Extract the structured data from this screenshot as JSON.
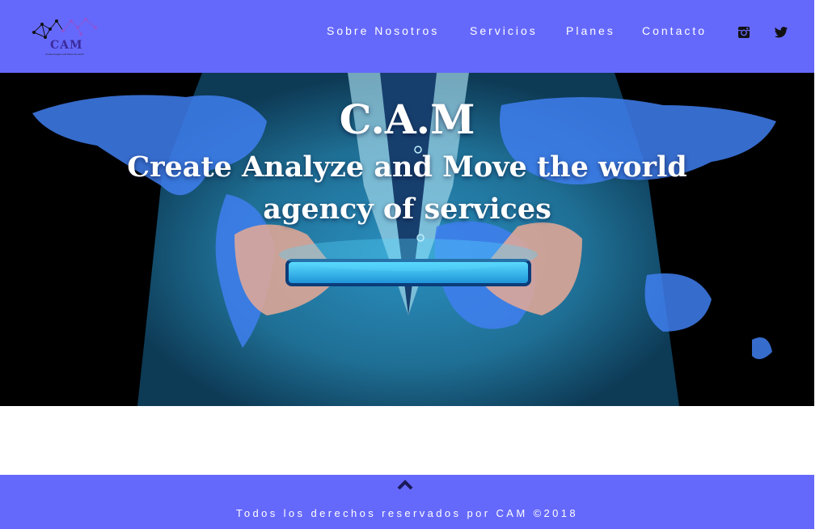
{
  "brand": {
    "logo_text": "CAM",
    "logo_tagline": "Create Analyze and Move the world",
    "accent_color": "#6569fb"
  },
  "nav": {
    "items": [
      {
        "label": "Sobre Nosotros"
      },
      {
        "label": "Servicios"
      },
      {
        "label": "Planes"
      },
      {
        "label": "Contacto"
      }
    ],
    "social": [
      "instagram-icon",
      "twitter-icon"
    ]
  },
  "hero": {
    "title": "C.A.M",
    "subtitle_line1": "Create Analyze and Move the world",
    "subtitle_line2": "agency of services"
  },
  "footer": {
    "back_to_top_icon": "chevron-up-icon",
    "copyright": "Todos los derechos reservados por CAM ©2018"
  }
}
